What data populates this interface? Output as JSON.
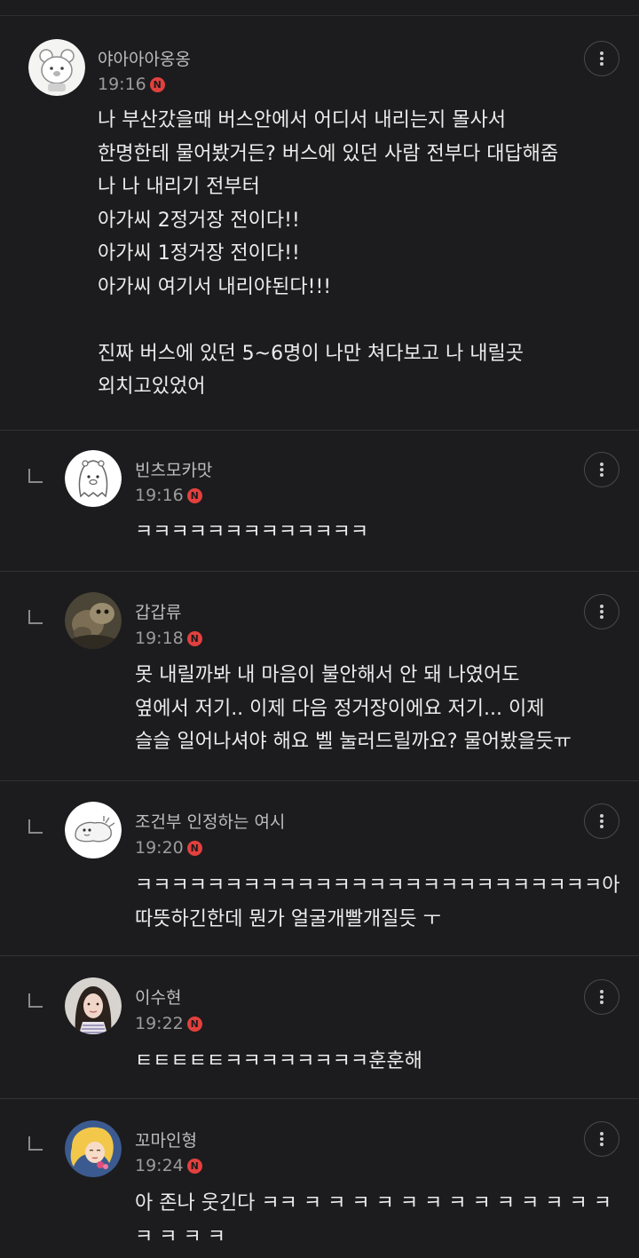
{
  "comments": [
    {
      "nickname": "야아아아옹옹",
      "time": "19:16",
      "badge": "N",
      "avatar": "cat-face-avatar",
      "text": "나 부산갔을때 버스안에서 어디서 내리는지 몰사서\n한명한테 물어봤거든? 버스에 있던 사람 전부다 대답해줌\n나 나 내리기 전부터\n아가씨 2정거장 전이다!!\n아가씨 1정거장 전이다!!\n아가씨 여기서 내리야된다!!!\n\n진짜 버스에 있던 5~6명이 나만 쳐다보고 나 내릴곳\n외치고있었어"
    },
    {
      "nickname": "빈츠모카맛",
      "time": "19:16",
      "badge": "N",
      "avatar": "ghost-bear-avatar",
      "text": "ㅋㅋㅋㅋㅋㅋㅋㅋㅋㅋㅋㅋㅋ"
    },
    {
      "nickname": "갑갑류",
      "time": "19:18",
      "badge": "N",
      "avatar": "animal-photo-avatar",
      "text": "못 내릴까봐 내 마음이 불안해서 안 돼 나였어도\n옆에서 저기.. 이제 다음 정거장이에요 저기... 이제\n슬슬 일어나셔야 해요 벨 눌러드릴까요? 물어봤을듯ㅠ"
    },
    {
      "nickname": "조건부 인정하는 여시",
      "time": "19:20",
      "badge": "N",
      "avatar": "creature-sketch-avatar",
      "text": "ㅋㅋㅋㅋㅋㅋㅋㅋㅋㅋㅋㅋㅋㅋㅋㅋㅋㅋㅋㅋㅋㅋㅋㅋㅋㅋ아\n따뜻하긴한데 뭔가 얼굴개빨개질듯 ㅜ"
    },
    {
      "nickname": "이수현",
      "time": "19:22",
      "badge": "N",
      "avatar": "person-photo-avatar",
      "text": "ㅌㅌㅌㅌㅌㅋㅋㅋㅋㅋㅋㅋㅋ훈훈해"
    },
    {
      "nickname": "꼬마인형",
      "time": "19:24",
      "badge": "N",
      "avatar": "princess-illustration-avatar",
      "text": "아 존나 웃긴다 ㅋㅋ ㅋ ㅋ ㅋ ㅋ ㅋ ㅋ ㅋ ㅋ ㅋ ㅋ ㅋ ㅋ ㅋ\nㅋ ㅋ ㅋ ㅋ"
    }
  ],
  "icons": {
    "more": "more-vertical-icon",
    "reply": "reply-arrow-icon",
    "new": "new-badge"
  },
  "colors": {
    "background": "#1c1c1e",
    "badge": "#e2403e",
    "text": "#ececec",
    "meta": "#9b9b9b"
  }
}
